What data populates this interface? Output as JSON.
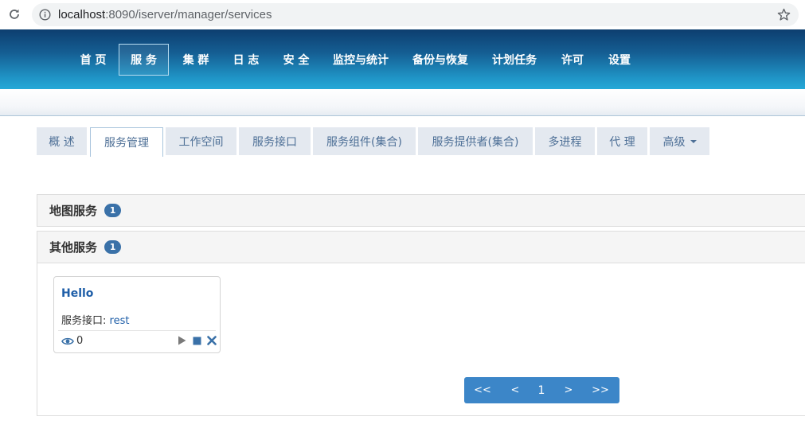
{
  "browser": {
    "url_host": "localhost",
    "url_path": ":8090/iserver/manager/services"
  },
  "topnav": {
    "items": [
      {
        "label": "首 页"
      },
      {
        "label": "服 务",
        "active": true
      },
      {
        "label": "集 群"
      },
      {
        "label": "日 志"
      },
      {
        "label": "安 全"
      },
      {
        "label": "监控与统计"
      },
      {
        "label": "备份与恢复"
      },
      {
        "label": "计划任务"
      },
      {
        "label": "许可"
      },
      {
        "label": "设置"
      }
    ]
  },
  "tabs": {
    "items": [
      {
        "label": "概 述"
      },
      {
        "label": "服务管理",
        "active": true
      },
      {
        "label": "工作空间"
      },
      {
        "label": "服务接口"
      },
      {
        "label": "服务组件(集合)"
      },
      {
        "label": "服务提供者(集合)"
      },
      {
        "label": "多进程"
      },
      {
        "label": "代 理"
      },
      {
        "label": "高级"
      }
    ]
  },
  "panels": [
    {
      "title": "地图服务",
      "count": "1"
    },
    {
      "title": "其他服务",
      "count": "1"
    }
  ],
  "service_card": {
    "name": "Hello",
    "interface_label": "服务接口:",
    "interface_value": "rest",
    "view_count": "0",
    "icons": [
      "eye-icon",
      "play-icon",
      "stop-icon",
      "delete-icon"
    ]
  },
  "pagination": {
    "first": "<<",
    "prev": "<",
    "page": "1",
    "next": ">",
    "last": ">>"
  },
  "colors": {
    "nav_dark": "#0d3e6f",
    "nav_light": "#25a9d8",
    "tab_text": "#4d6f96",
    "link": "#1e5ea8",
    "badge": "#3a71a8",
    "pager": "#3c86c8"
  }
}
